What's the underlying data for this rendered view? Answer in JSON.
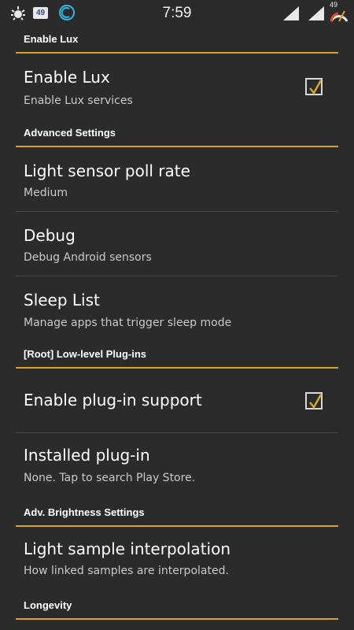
{
  "status_bar": {
    "time": "7:59",
    "notification_badge": "49",
    "battery_level": "49",
    "icons": [
      "android-debug-icon",
      "notification-badge-icon",
      "sync-icon",
      "signal-icon",
      "signal-icon-2",
      "battery-icon"
    ]
  },
  "accent_color": "#d8a520",
  "sections": {
    "enable_lux": {
      "header": "Enable Lux",
      "enable": {
        "title": "Enable Lux",
        "summary": "Enable Lux services",
        "checked": true
      }
    },
    "advanced": {
      "header": "Advanced Settings",
      "poll_rate": {
        "title": "Light sensor poll rate",
        "summary": "Medium"
      },
      "debug": {
        "title": "Debug",
        "summary": "Debug Android sensors"
      },
      "sleep_list": {
        "title": "Sleep List",
        "summary": "Manage apps that trigger sleep mode"
      }
    },
    "root_plugins": {
      "header": "[Root] Low-level Plug-ins",
      "plugin_support": {
        "title": "Enable plug-in support",
        "checked": true
      },
      "installed": {
        "title": "Installed plug-in",
        "summary": "None. Tap to search Play Store."
      }
    },
    "adv_brightness": {
      "header": "Adv. Brightness Settings",
      "interpolation": {
        "title": "Light sample interpolation",
        "summary": "How linked samples are interpolated."
      }
    },
    "longevity": {
      "header": "Longevity"
    }
  }
}
